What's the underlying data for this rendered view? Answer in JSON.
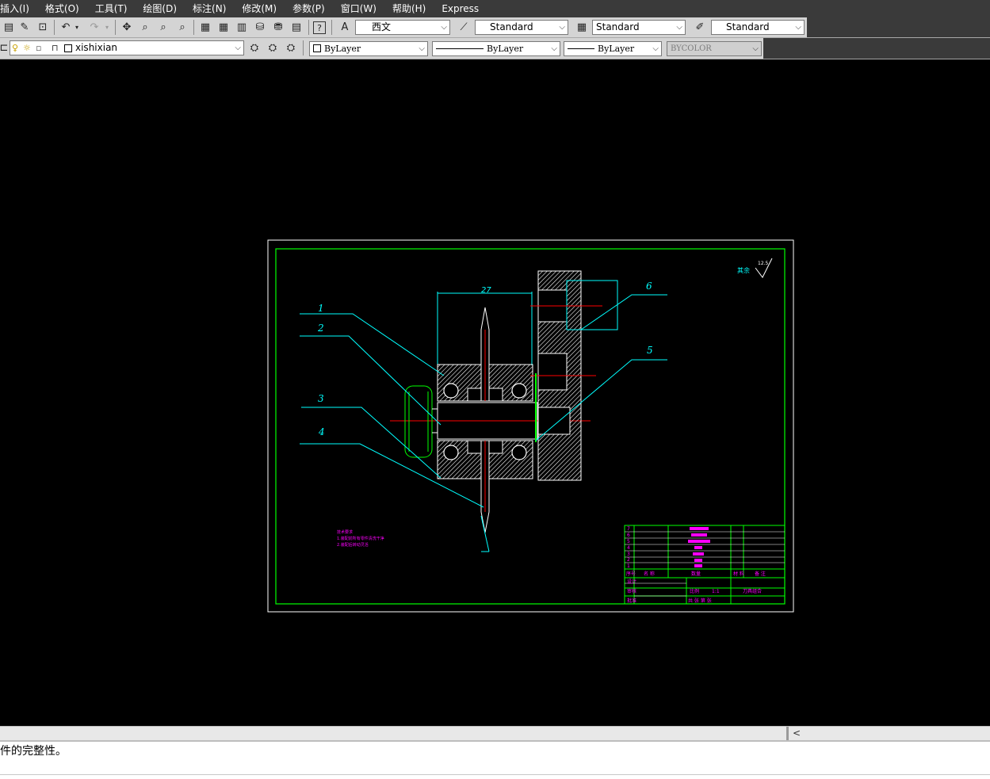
{
  "menu": {
    "items": [
      "插入(I)",
      "格式(O)",
      "工具(T)",
      "绘图(D)",
      "标注(N)",
      "修改(M)",
      "参数(P)",
      "窗口(W)",
      "帮助(H)",
      "Express"
    ]
  },
  "toolbar1": {
    "text_style": "西文",
    "dim_style": "Standard",
    "table_style": "Standard",
    "multileader_style": "Standard"
  },
  "toolbar2": {
    "layer": "xishixian",
    "color": "ByLayer",
    "linetype": "ByLayer",
    "lineweight": "ByLayer",
    "plot_style": "BYCOLOR"
  },
  "drawing": {
    "dim_27": "27",
    "balloons": [
      "1",
      "2",
      "3",
      "4",
      "5",
      "6"
    ],
    "roughness_label": "其余",
    "roughness_value": "12.5",
    "notes_title": "技术要求",
    "notes_lines": [
      "1.装配前所有零件清洗干净",
      "2.装配后转动灵活"
    ],
    "title_block": {
      "rows": [
        "7",
        "6",
        "5",
        "4",
        "3",
        "2",
        "1"
      ],
      "header": [
        "序号",
        "名 称",
        "数量",
        "材 料",
        "备 注"
      ],
      "drawing_name": "刀具组合",
      "scale_label": "比例",
      "scale_value": "1:1",
      "row_labels": [
        "设计",
        "审核",
        "批准"
      ],
      "sheet_label": "共 张 第 张"
    }
  },
  "command": {
    "text": "件的完整性。"
  },
  "colors": {
    "cad_cyan": "#00ffff",
    "cad_green": "#00ff00",
    "cad_magenta": "#ff00ff",
    "cad_red": "#ff0000",
    "cad_white": "#ffffff"
  }
}
